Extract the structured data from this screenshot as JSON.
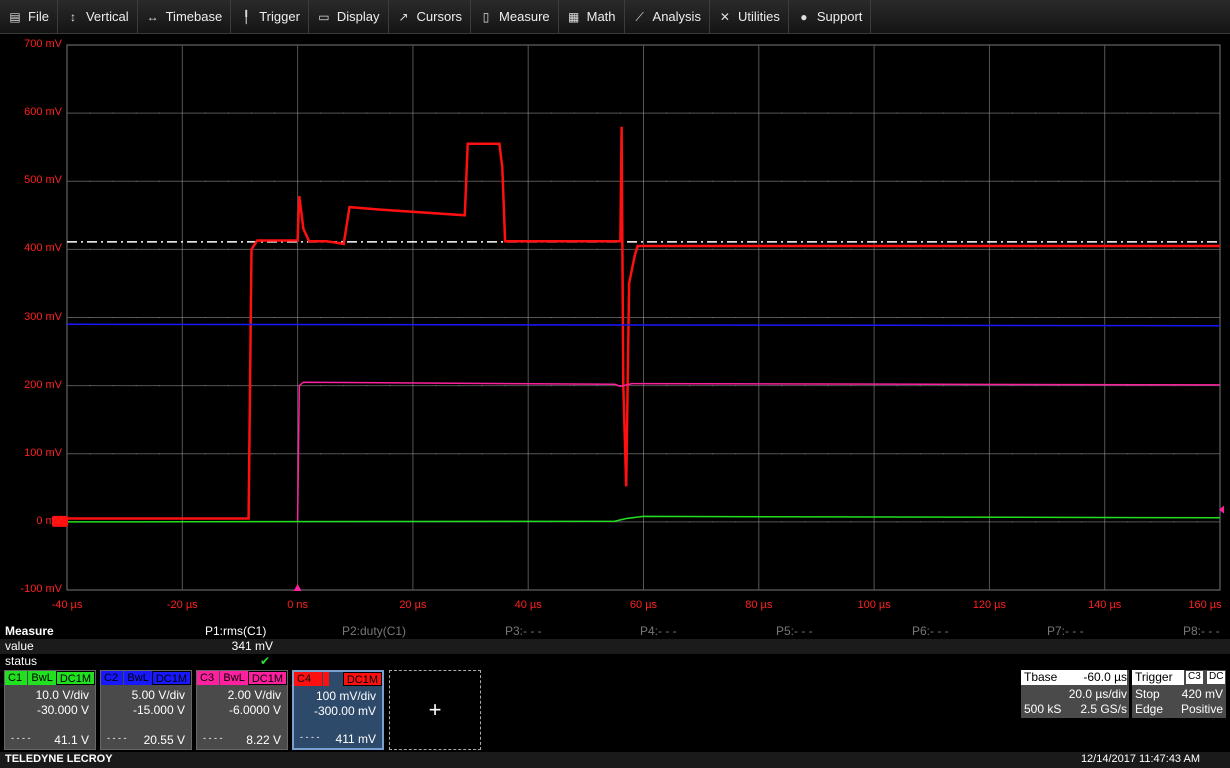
{
  "menu": [
    {
      "label": "File",
      "icon": "file-icon"
    },
    {
      "label": "Vertical",
      "icon": "vertical-icon"
    },
    {
      "label": "Timebase",
      "icon": "timebase-icon"
    },
    {
      "label": "Trigger",
      "icon": "trigger-icon"
    },
    {
      "label": "Display",
      "icon": "display-icon"
    },
    {
      "label": "Cursors",
      "icon": "cursors-icon"
    },
    {
      "label": "Measure",
      "icon": "measure-icon"
    },
    {
      "label": "Math",
      "icon": "math-icon"
    },
    {
      "label": "Analysis",
      "icon": "analysis-icon"
    },
    {
      "label": "Utilities",
      "icon": "utilities-icon"
    },
    {
      "label": "Support",
      "icon": "support-icon"
    }
  ],
  "y_labels": [
    "700 mV",
    "600 mV",
    "500 mV",
    "400 mV",
    "300 mV",
    "200 mV",
    "100 mV",
    "0 mV",
    "-100 mV"
  ],
  "x_labels": [
    "-40 µs",
    "-20 µs",
    "0 ns",
    "20 µs",
    "40 µs",
    "60 µs",
    "80 µs",
    "100 µs",
    "120 µs",
    "140 µs",
    "160 µs"
  ],
  "colors": {
    "c1": "#20e020",
    "c2": "#1818ff",
    "c3": "#ff20a0",
    "c4": "#ff1010",
    "axis_label": "#ff2020"
  },
  "measure": {
    "title": "Measure",
    "row_value": "value",
    "row_status": "status",
    "params": [
      "P1:rms(C1)",
      "P2:duty(C1)",
      "P3:- - -",
      "P4:- - -",
      "P5:- - -",
      "P6:- - -",
      "P7:- - -",
      "P8:- - -"
    ],
    "p1_value": "341 mV",
    "p1_status": "✔"
  },
  "channels": [
    {
      "name": "C1",
      "bwl": "BwL",
      "coupling": "DC1M",
      "vdiv": "10.0 V/div",
      "offset": "-30.000 V",
      "readout": "41.1 V",
      "color": "#20e020"
    },
    {
      "name": "C2",
      "bwl": "BwL",
      "coupling": "DC1M",
      "vdiv": "5.00 V/div",
      "offset": "-15.000 V",
      "readout": "20.55 V",
      "color": "#1818ff"
    },
    {
      "name": "C3",
      "bwl": "BwL",
      "coupling": "DC1M",
      "vdiv": "2.00 V/div",
      "offset": "-6.0000 V",
      "readout": "8.22 V",
      "color": "#ff20a0"
    },
    {
      "name": "C4",
      "bwl": "",
      "coupling": "DC1M",
      "vdiv": "100 mV/div",
      "offset": "-300.00 mV",
      "readout": "411 mV",
      "color": "#ff1010"
    }
  ],
  "channel_dash": "- - - -",
  "add_label": "+",
  "tbase": {
    "label": "Tbase",
    "delay": "-60.0 µs",
    "tdiv": "20.0 µs/div",
    "samples": "500 kS",
    "rate": "2.5 GS/s"
  },
  "trigger": {
    "label": "Trigger",
    "source": "C3",
    "coupling": "DC",
    "mode": "Stop",
    "level": "420 mV",
    "type": "Edge",
    "slope": "Positive"
  },
  "footer": {
    "brand": "TELEDYNE LECROY",
    "datetime": "12/14/2017 11:47:43 AM"
  },
  "chart_data": {
    "type": "line",
    "xlabel": "",
    "ylabel": "",
    "xlim": [
      -40,
      160
    ],
    "ylim": [
      -100,
      700
    ],
    "x_unit": "µs",
    "y_unit": "mV",
    "cursor_level_mV": 411,
    "series": [
      {
        "channel": "C4",
        "color": "#ff1010",
        "points": [
          [
            -40,
            5
          ],
          [
            -8.5,
            5
          ],
          [
            -8,
            400
          ],
          [
            -7,
            413
          ],
          [
            0,
            413
          ],
          [
            0.3,
            478
          ],
          [
            1,
            430
          ],
          [
            2,
            412
          ],
          [
            5,
            412
          ],
          [
            8,
            408
          ],
          [
            9,
            462
          ],
          [
            15,
            458
          ],
          [
            29,
            450
          ],
          [
            29.5,
            555
          ],
          [
            35,
            555
          ],
          [
            35.5,
            520
          ],
          [
            36,
            412
          ],
          [
            56,
            412
          ],
          [
            56.2,
            580
          ],
          [
            56.5,
            200
          ],
          [
            57,
            52
          ],
          [
            57.5,
            350
          ],
          [
            58.5,
            392
          ],
          [
            59,
            405
          ],
          [
            100,
            405
          ],
          [
            160,
            405
          ]
        ]
      },
      {
        "channel": "C2",
        "color": "#1818ff",
        "points": [
          [
            -40,
            290
          ],
          [
            160,
            288
          ]
        ]
      },
      {
        "channel": "C3",
        "color": "#ff20a0",
        "points": [
          [
            0,
            0
          ],
          [
            0.3,
            200
          ],
          [
            1,
            205
          ],
          [
            55,
            202
          ],
          [
            56,
            199
          ],
          [
            58,
            203
          ],
          [
            160,
            201
          ]
        ]
      },
      {
        "channel": "C1",
        "color": "#20e020",
        "points": [
          [
            -40,
            0
          ],
          [
            55,
            1
          ],
          [
            57,
            5
          ],
          [
            60,
            8
          ],
          [
            160,
            6
          ]
        ]
      }
    ]
  }
}
